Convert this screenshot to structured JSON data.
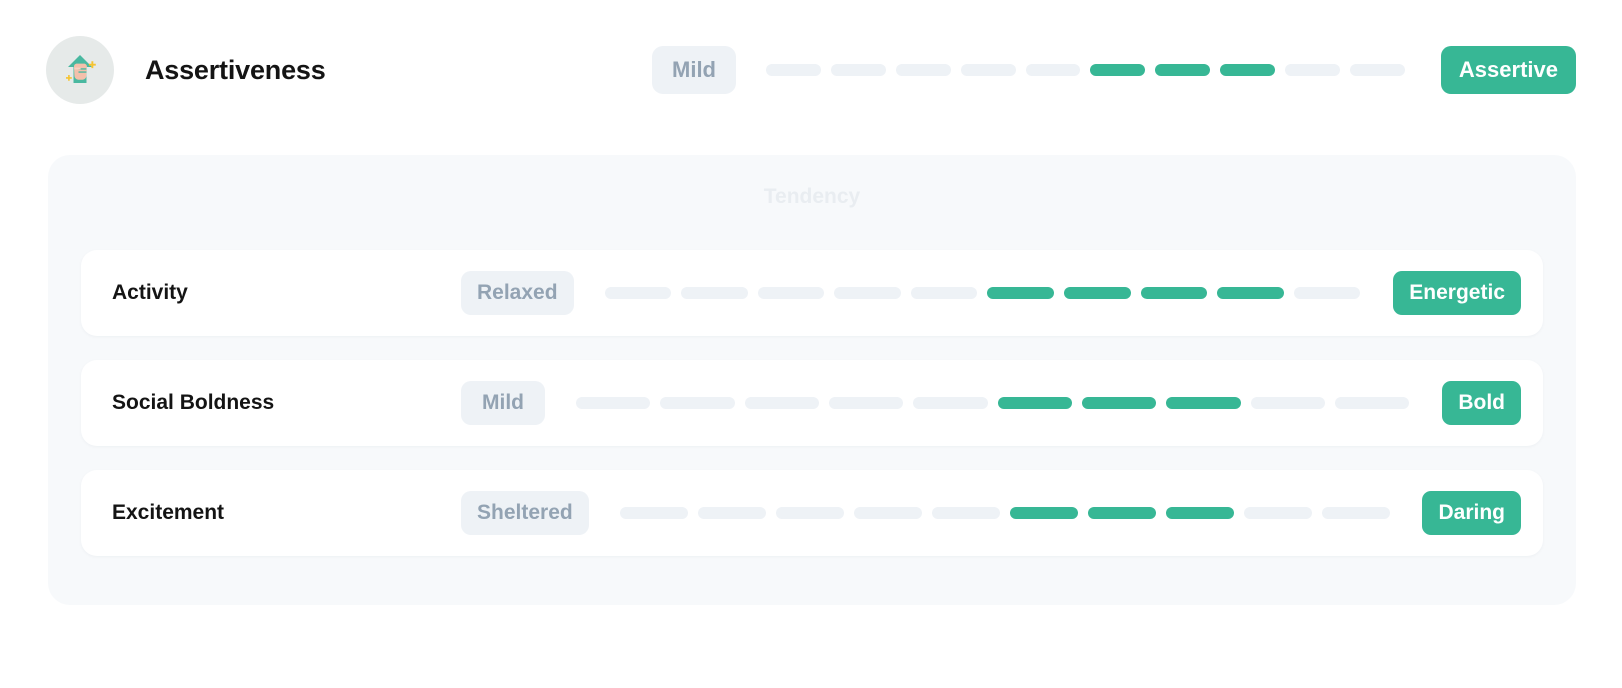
{
  "header": {
    "icon_name": "assertiveness-fist-arrow-icon",
    "title": "Assertiveness",
    "scale": {
      "left_label": "Mild",
      "right_label": "Assertive",
      "segments_total": 10,
      "segments_filled_indices": [
        5,
        6,
        7
      ]
    }
  },
  "panel": {
    "heading": "Tendency"
  },
  "traits": [
    {
      "name": "Activity",
      "left_label": "Relaxed",
      "right_label": "Energetic",
      "segments_total": 10,
      "segments_filled_indices": [
        5,
        6,
        7,
        8
      ]
    },
    {
      "name": "Social Boldness",
      "left_label": "Mild",
      "right_label": "Bold",
      "segments_total": 10,
      "segments_filled_indices": [
        5,
        6,
        7
      ]
    },
    {
      "name": "Excitement",
      "left_label": "Sheltered",
      "right_label": "Daring",
      "segments_total": 10,
      "segments_filled_indices": [
        5,
        6,
        7
      ]
    }
  ],
  "colors": {
    "accent": "#37b795",
    "segment_empty": "#eef2f6",
    "pill_muted_bg": "#eef2f6",
    "pill_muted_text": "#93a3b3",
    "panel_bg": "#f7f9fb",
    "card_bg": "#ffffff",
    "heading_muted": "#e9edf1",
    "title_text": "#141414",
    "avatar_bg": "#e6eae9"
  },
  "chart_data": {
    "type": "bar",
    "title": "Assertiveness",
    "categories": [
      "Assertiveness",
      "Activity",
      "Social Boldness",
      "Excitement"
    ],
    "values": [
      8,
      9,
      8,
      8
    ],
    "ylim": [
      0,
      10
    ],
    "xlabel": "",
    "ylabel": "Tendency",
    "notes": "Each row is a 10-segment discrete scale; value = index of last filled segment (1-based). Filled segments are contiguous runs: Assertiveness 6-8, Activity 6-9, Social Boldness 6-8, Excitement 6-8."
  }
}
